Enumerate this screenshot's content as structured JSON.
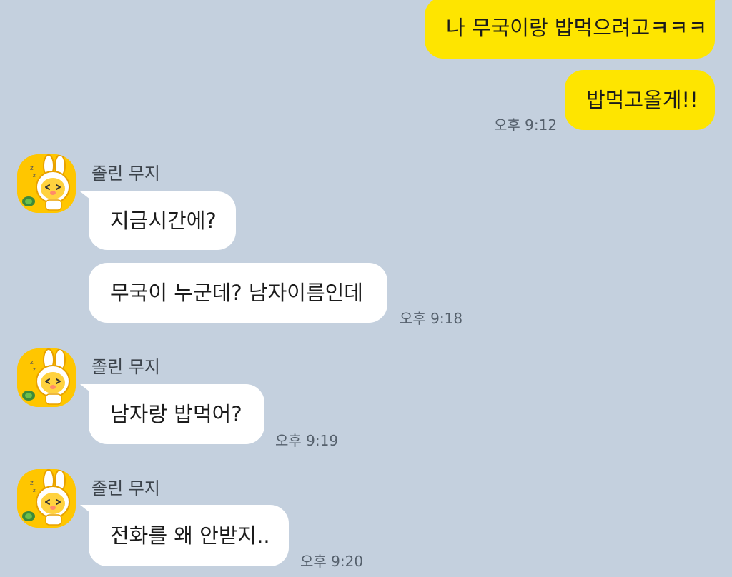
{
  "colors": {
    "background": "#c4d0de",
    "outgoing_bubble": "#fee500",
    "incoming_bubble": "#ffffff",
    "avatar_bg": "#ffc600",
    "timestamp": "#55606c"
  },
  "outgoing": {
    "messages": [
      {
        "text": "나 무국이랑 밥먹으려고ㅋㅋㅋ"
      },
      {
        "text": "밥먹고올게!!"
      }
    ],
    "time": "오후 9:12"
  },
  "incoming": [
    {
      "sender": "졸린 무지",
      "avatar_icon": "muzi-avatar-icon",
      "messages": [
        {
          "text": "지금시간에?"
        },
        {
          "text": "무국이 누군데? 남자이름인데"
        }
      ],
      "time": "오후 9:18"
    },
    {
      "sender": "졸린 무지",
      "avatar_icon": "muzi-avatar-icon",
      "messages": [
        {
          "text": "남자랑 밥먹어?"
        }
      ],
      "time": "오후 9:19"
    },
    {
      "sender": "졸린 무지",
      "avatar_icon": "muzi-avatar-icon",
      "messages": [
        {
          "text": "전화를 왜 안받지.."
        }
      ],
      "time": "오후 9:20"
    }
  ]
}
